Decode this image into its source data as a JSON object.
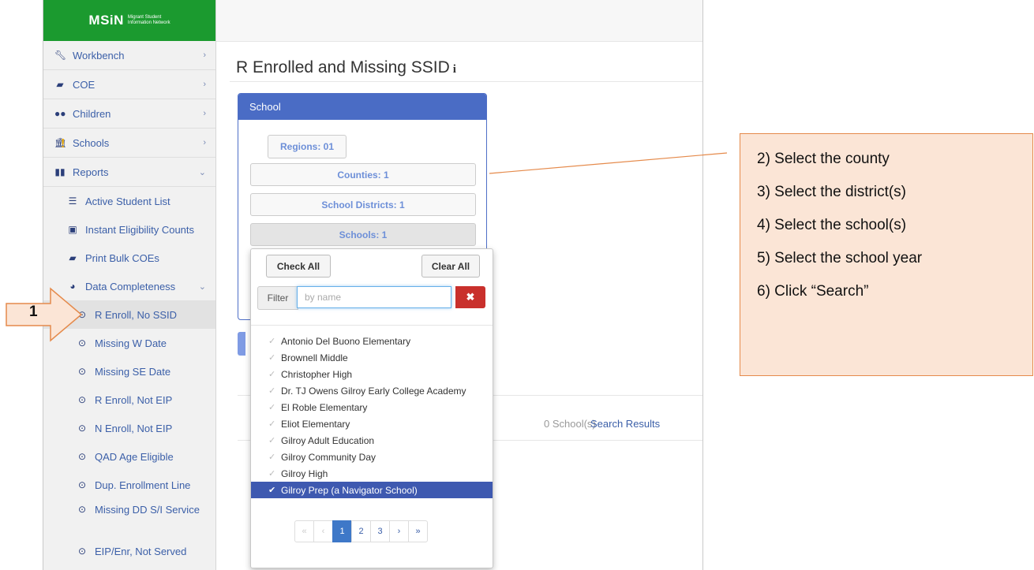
{
  "logo": {
    "brand": "MSiN",
    "tag_line1": "Migrant Student",
    "tag_line2": "Information Network"
  },
  "sidebar": {
    "items": [
      {
        "label": "Workbench",
        "icon": "wrench-icon"
      },
      {
        "label": "COE",
        "icon": "book-icon"
      },
      {
        "label": "Children",
        "icon": "users-icon"
      },
      {
        "label": "Schools",
        "icon": "institution-icon"
      },
      {
        "label": "Reports",
        "icon": "bar-chart-icon"
      }
    ],
    "reports_sub": [
      {
        "label": "Active Student List",
        "icon": "list-icon"
      },
      {
        "label": "Instant Eligibility Counts",
        "icon": "counter-icon"
      },
      {
        "label": "Print Bulk COEs",
        "icon": "book-icon"
      },
      {
        "label": "Data Completeness",
        "icon": "pie-chart-icon"
      }
    ],
    "data_completeness_sub": [
      {
        "label": "R Enroll, No SSID"
      },
      {
        "label": "Missing W Date"
      },
      {
        "label": "Missing SE Date"
      },
      {
        "label": "R Enroll, Not EIP"
      },
      {
        "label": "N Enroll, Not EIP"
      },
      {
        "label": "QAD Age Eligible"
      },
      {
        "label": "Dup. Enrollment Line"
      },
      {
        "label": "Missing DD S/I Service"
      },
      {
        "label": "EIP/Enr, Not Served"
      }
    ]
  },
  "page": {
    "title": "R Enrolled and Missing SSID",
    "info_glyph": "i"
  },
  "school_panel": {
    "header": "School",
    "warning_glyph": "!",
    "regions": "Regions:  01",
    "counties": "Counties: 1",
    "districts": "School Districts: 1",
    "schools": "Schools: 1"
  },
  "dropdown": {
    "check_all": "Check All",
    "clear_all": "Clear All",
    "filter_label": "Filter",
    "filter_placeholder": "by name",
    "filter_value": "",
    "clear_glyph": "✖",
    "options": [
      {
        "label": "Antonio Del Buono Elementary",
        "selected": false
      },
      {
        "label": "Brownell Middle",
        "selected": false
      },
      {
        "label": "Christopher High",
        "selected": false
      },
      {
        "label": "Dr. TJ Owens Gilroy Early College Academy",
        "selected": false
      },
      {
        "label": "El Roble Elementary",
        "selected": false
      },
      {
        "label": "Eliot Elementary",
        "selected": false
      },
      {
        "label": "Gilroy Adult Education",
        "selected": false
      },
      {
        "label": "Gilroy Community Day",
        "selected": false
      },
      {
        "label": "Gilroy High",
        "selected": false
      },
      {
        "label": "Gilroy Prep (a Navigator School)",
        "selected": true
      }
    ],
    "pager": [
      "«",
      "‹",
      "1",
      "2",
      "3",
      "›",
      "»"
    ],
    "current_page": "1"
  },
  "results": {
    "count": "0 School(s)",
    "link": "Search Results"
  },
  "annotation": {
    "marker": "1",
    "steps": [
      "2) Select the county",
      "3) Select the district(s)",
      "4) Select the school(s)",
      "5) Select the school year",
      "6) Click “Search”"
    ]
  },
  "colors": {
    "brand_green": "#1b9a2f",
    "panel_blue": "#4a6cc5",
    "selected_blue": "#3e59b0",
    "callout_fill": "#fbe5d6",
    "callout_border": "#e58a4b",
    "danger": "#c9302c"
  }
}
